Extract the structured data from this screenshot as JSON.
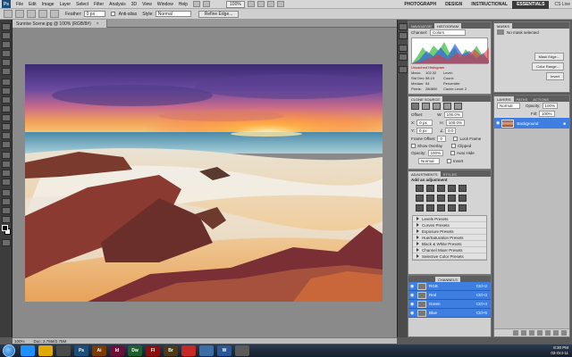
{
  "menubar": {
    "app_icon": "Ps",
    "items": [
      "File",
      "Edit",
      "Image",
      "Layer",
      "Select",
      "Filter",
      "Analysis",
      "3D",
      "View",
      "Window",
      "Help"
    ],
    "zoom": "100%",
    "workspaces": [
      "PHOTOGRAPH",
      "DESIGN",
      "INSTRUCTIONAL",
      "ESSENTIALS"
    ],
    "active_workspace": "ESSENTIALS",
    "cs_live": "CS Live"
  },
  "options": {
    "feather_label": "Feather:",
    "feather_value": "0 px",
    "antialias_label": "Anti-alias",
    "style_label": "Style:",
    "style_value": "Normal",
    "refine_edge": "Refine Edge..."
  },
  "document": {
    "tab_title": "Sunrise Scene.jpg @ 100% (RGB/8#)",
    "close": "×"
  },
  "status": {
    "zoom": "100%",
    "doc_size": "Doc: 2.75M/2.75M"
  },
  "panels": {
    "histogram": {
      "tabs": [
        "NAVIGATOR",
        "HISTOGRAM"
      ],
      "channel_label": "Channel:",
      "channel_value": "Colors",
      "warning": "Uncached Histogram",
      "stats": [
        [
          "Mean:",
          "102.32",
          "Level:",
          ""
        ],
        [
          "Std Dev:",
          "58.19",
          "Count:",
          ""
        ],
        [
          "Median:",
          "94",
          "Percentile:",
          ""
        ],
        [
          "Pixels:",
          "280800",
          "Cache Level:",
          "2"
        ]
      ]
    },
    "masks": {
      "tabs": [
        "MASKS"
      ],
      "title": "No mask selected",
      "buttons": [
        "Mask Edge...",
        "Color Range...",
        "Invert"
      ]
    },
    "clone": {
      "tabs": [
        "CLONE SOURCE"
      ],
      "offset_label": "Offset:",
      "w_value": "100.0%",
      "h_value": "100.0%",
      "x_value": "0 px",
      "y_value": "0 px",
      "angle_value": "0.0",
      "frame_offset_label": "Frame Offset:",
      "frame_offset_value": "0",
      "lock_frame": "Lock Frame",
      "show_overlay": "Show Overlay",
      "clipped": "Clipped",
      "opacity_label": "Opacity:",
      "opacity_value": "100%",
      "auto_hide": "Auto Hide",
      "blend_value": "Normal",
      "invert": "Invert"
    },
    "layers": {
      "tabs": [
        "LAYERS",
        "PATHS",
        "ACTIONS"
      ],
      "blend": "Normal",
      "opacity_label": "Opacity:",
      "opacity": "100%",
      "fill_label": "Fill:",
      "fill": "100%",
      "layer_name": "Background"
    },
    "adjustments": {
      "tabs": [
        "ADJUSTMENTS",
        "STYLES"
      ],
      "title": "Add an adjustment",
      "presets": [
        "Levels Presets",
        "Curves Presets",
        "Exposure Presets",
        "Hue/Saturation Presets",
        "Black & White Presets",
        "Channel Mixer Presets",
        "Selective Color Presets"
      ]
    },
    "channels": {
      "tabs": [
        "CHANNELS"
      ],
      "rows": [
        {
          "name": "RGB",
          "shortcut": "Ctrl+2"
        },
        {
          "name": "Red",
          "shortcut": "Ctrl+3"
        },
        {
          "name": "Green",
          "shortcut": "Ctrl+4"
        },
        {
          "name": "Blue",
          "shortcut": "Ctrl+5"
        }
      ]
    }
  },
  "taskbar": {
    "apps": [
      {
        "label": "",
        "color": "#1e90ff",
        "icon": "ie-icon"
      },
      {
        "label": "",
        "color": "#e0a800",
        "icon": "folder-icon"
      },
      {
        "label": "",
        "color": "#4a4a4a",
        "icon": "media-icon"
      },
      {
        "label": "Ps",
        "color": "#1b4f7a",
        "icon": "photoshop-icon"
      },
      {
        "label": "Ai",
        "color": "#7a3b00",
        "icon": "illustrator-icon"
      },
      {
        "label": "Id",
        "color": "#6b0f3a",
        "icon": "indesign-icon"
      },
      {
        "label": "Dw",
        "color": "#1f5f2f",
        "icon": "dreamweaver-icon"
      },
      {
        "label": "Fl",
        "color": "#8a1010",
        "icon": "flash-icon"
      },
      {
        "label": "Br",
        "color": "#4a3a1a",
        "icon": "bridge-icon"
      },
      {
        "label": "",
        "color": "#c62828",
        "icon": "acrobat-icon"
      },
      {
        "label": "",
        "color": "#3a6ea5",
        "icon": "app-icon"
      },
      {
        "label": "W",
        "color": "#2b5797",
        "icon": "word-icon"
      },
      {
        "label": "",
        "color": "#5a5a5a",
        "icon": "app2-icon"
      }
    ],
    "time": "8:30 PM",
    "date": "03-Oct-11"
  }
}
